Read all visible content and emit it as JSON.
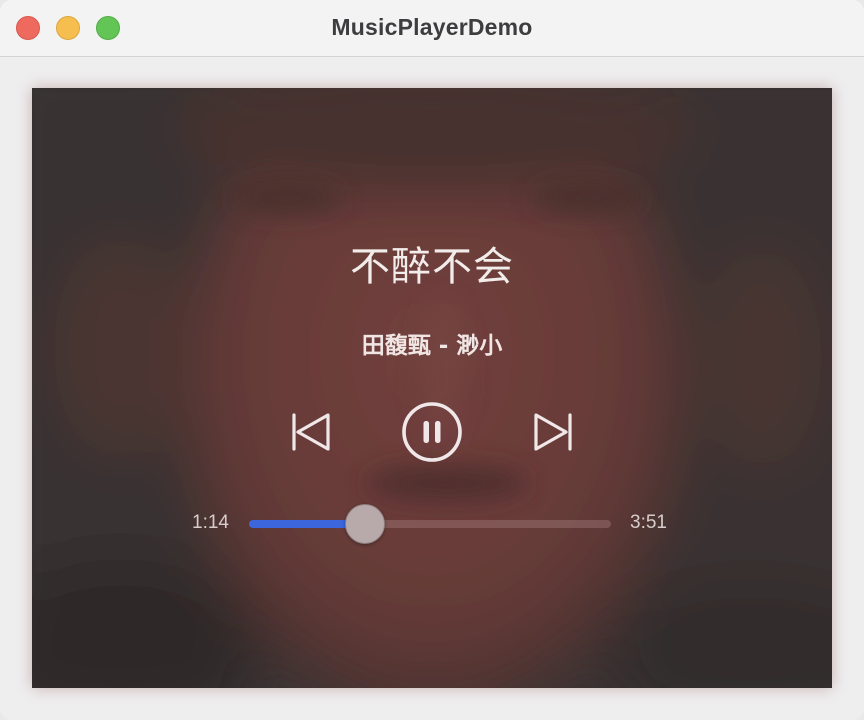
{
  "window": {
    "title": "MusicPlayerDemo"
  },
  "player": {
    "song_title": "不醉不会",
    "subtitle": "田馥甄 - 渺小",
    "elapsed": "1:14",
    "duration": "3:51",
    "progress_fraction": 0.32,
    "is_playing": true,
    "controls": {
      "previous_icon": "skip-back-icon",
      "play_pause_icon": "pause-circle-icon",
      "next_icon": "skip-forward-icon"
    },
    "colors": {
      "progress_fill": "#3b66dc",
      "track": "#7a5a5a",
      "thumb": "#b8a9ab",
      "text": "#f2ecea",
      "artwork_tint": "#6e403c"
    }
  }
}
